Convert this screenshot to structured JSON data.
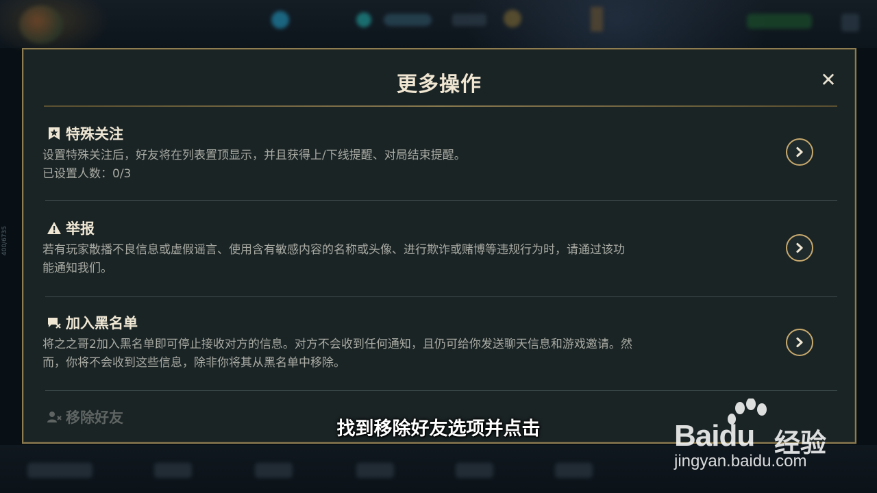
{
  "dialog": {
    "title": "更多操作",
    "close_label": "✕",
    "items": [
      {
        "title": "特殊关注",
        "icon": "star-bookmark-icon",
        "desc_line1": "设置特殊关注后，好友将在列表置顶显示，并且获得上/下线提醒、对局结束提醒。",
        "desc_line2": "已设置人数：0/3"
      },
      {
        "title": "举报",
        "icon": "warning-icon",
        "desc_line1": "若有玩家散播不良信息或虚假谣言、使用含有敏感内容的名称或头像、进行欺诈或赌博等违规行为时，请通过该功",
        "desc_line2": "能通知我们。"
      },
      {
        "title": "加入黑名单",
        "icon": "block-chat-icon",
        "desc_line1": "将之之哥2加入黑名单即可停止接收对方的信息。对方不会收到任何通知，且仍可给你发送聊天信息和游戏邀请。然",
        "desc_line2": "而，你将不会收到这些信息，除非你将其从黑名单中移除。"
      },
      {
        "title": "移除好友",
        "icon": "remove-user-icon"
      }
    ]
  },
  "subtitle": "找到移除好友选项并点击",
  "watermark": {
    "logo": "Baidu",
    "cn": "经验",
    "url": "jingyan.baidu.com"
  },
  "side_text": "400/6735",
  "colors": {
    "gold": "#c8aa6e",
    "panel_bg": "#1b2425",
    "title_text": "#f0e6d2",
    "desc_text": "#a8aaa3"
  }
}
